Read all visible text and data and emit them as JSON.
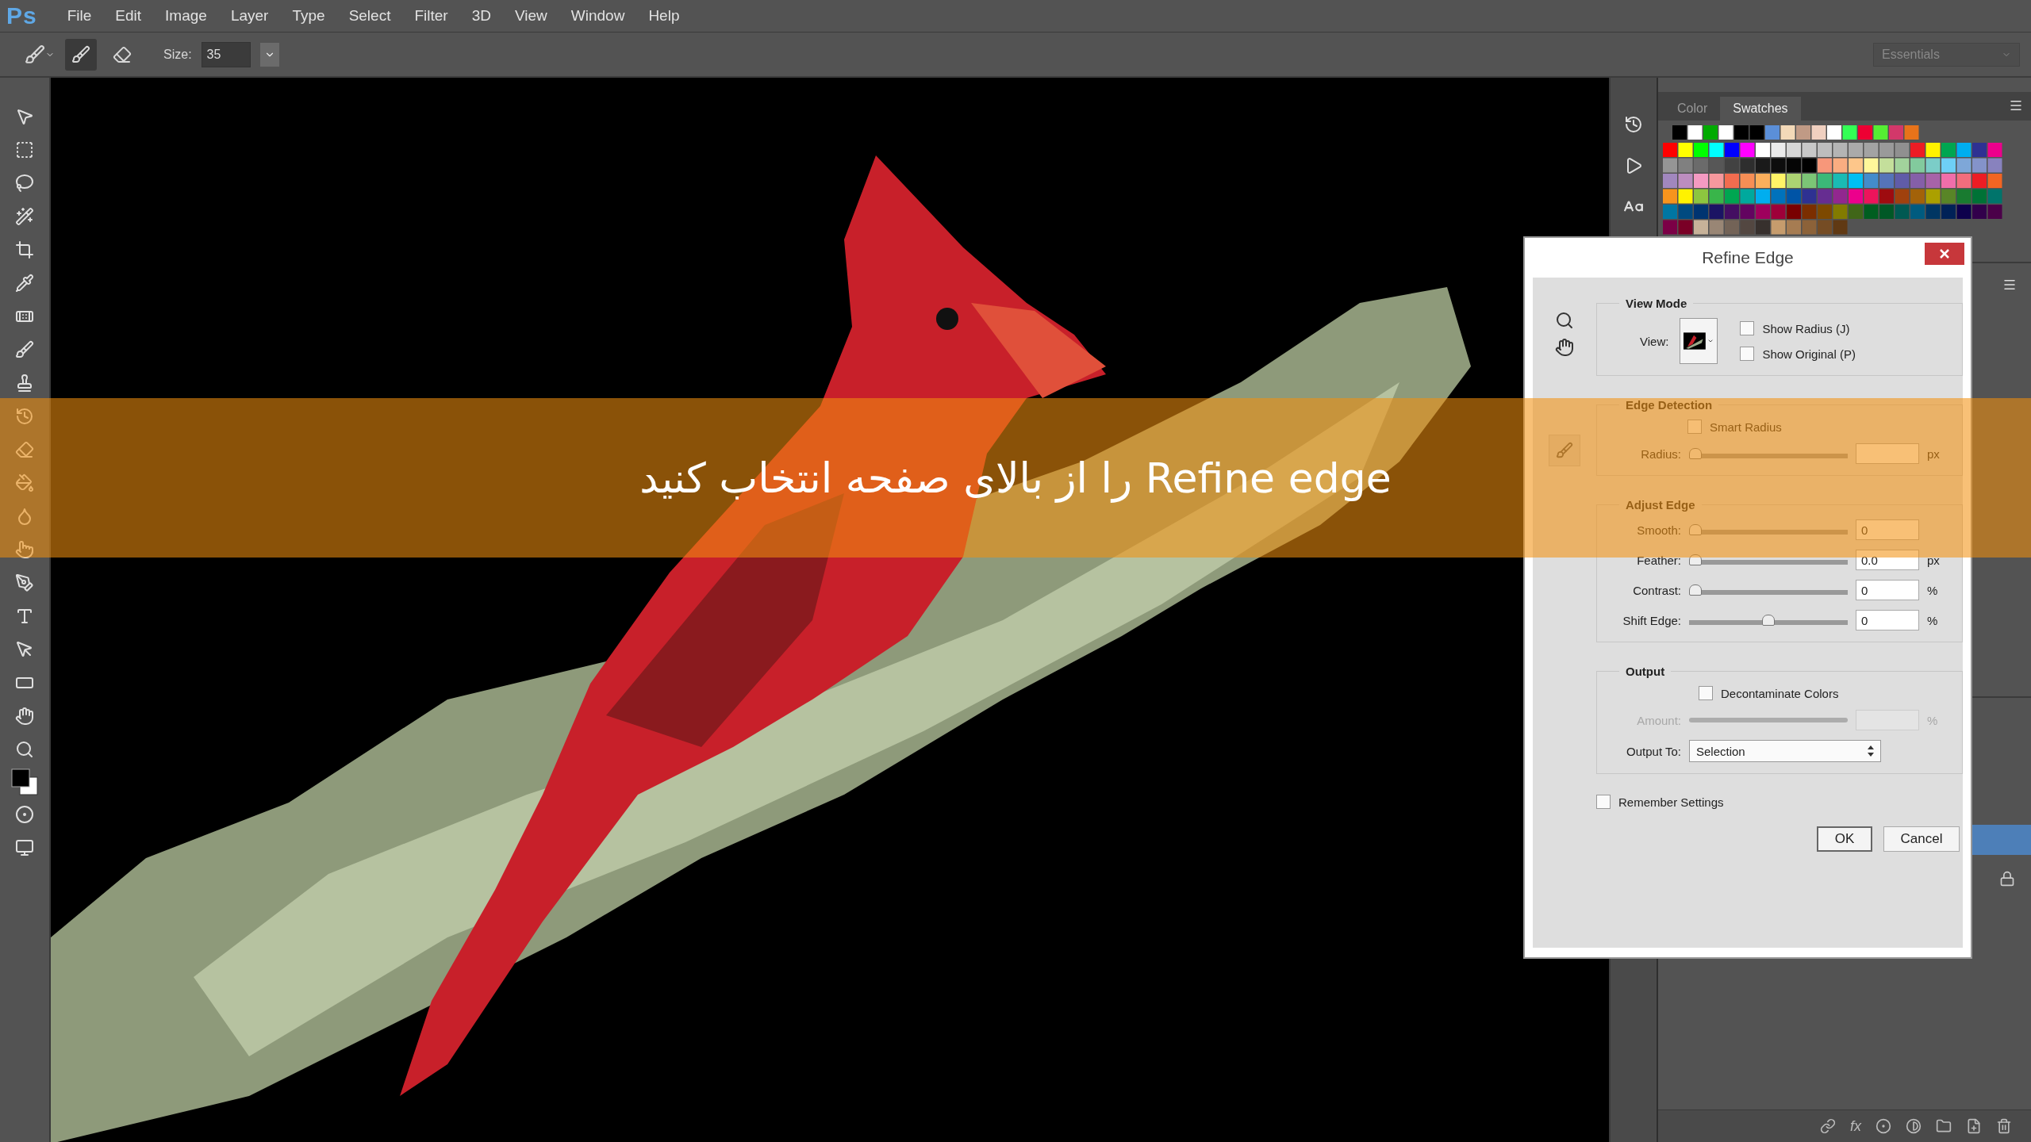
{
  "app": {
    "logo": "Ps",
    "menu": [
      "File",
      "Edit",
      "Image",
      "Layer",
      "Type",
      "Select",
      "Filter",
      "3D",
      "View",
      "Window",
      "Help"
    ]
  },
  "options_bar": {
    "mode_buttons": [
      {
        "selected": true
      },
      {
        "selected": false
      }
    ],
    "size_label": "Size:",
    "size_value": "35",
    "workspace": "Essentials"
  },
  "panels": {
    "tabs": [
      {
        "label": "Color",
        "selected": false
      },
      {
        "label": "Swatches",
        "selected": true
      }
    ],
    "layers_footer_fx": "fx"
  },
  "caption": "Refine edge را از بالای صفحه انتخاب کنید",
  "dialog": {
    "title": "Refine Edge",
    "view_mode": {
      "title": "View Mode",
      "view_label": "View:",
      "options": [
        {
          "label": "Show Radius (J)",
          "checked": false
        },
        {
          "label": "Show Original (P)",
          "checked": false
        }
      ]
    },
    "edge_detection": {
      "title": "Edge Detection",
      "smart_radius": {
        "label": "Smart Radius",
        "checked": false
      },
      "radius": {
        "label": "Radius:",
        "level": 0,
        "unit": "px"
      }
    },
    "adjust_edge": {
      "title": "Adjust Edge",
      "sliders": [
        {
          "label": "Smooth:",
          "level": 0,
          "value": "0"
        },
        {
          "label": "Feather:",
          "level": 0,
          "value": "0.0",
          "unit": "px"
        },
        {
          "label": "Contrast:",
          "level": 0,
          "value": "0",
          "unit": "%"
        },
        {
          "label": "Shift Edge:",
          "level": 0.5,
          "value": "0",
          "unit": "%"
        }
      ]
    },
    "output": {
      "title": "Output",
      "decontaminate": {
        "label": "Decontaminate Colors",
        "checked": false
      },
      "amount": {
        "label": "Amount:",
        "unit": "%",
        "disabled": true
      },
      "output_to": {
        "label": "Output To:",
        "value": "Selection"
      }
    },
    "remember": {
      "label": "Remember Settings",
      "checked": false
    },
    "buttons": [
      "OK",
      "Cancel"
    ]
  }
}
